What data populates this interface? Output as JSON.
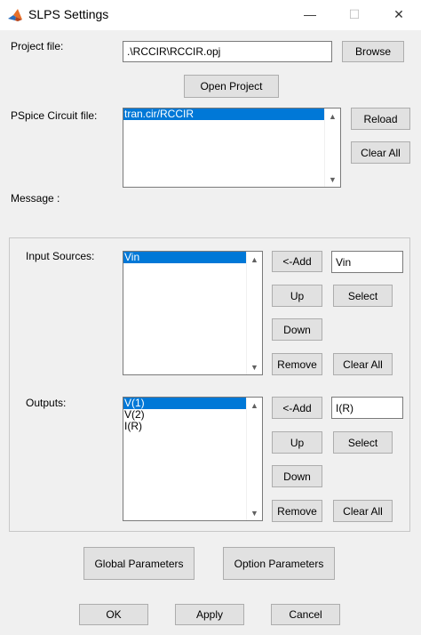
{
  "window": {
    "title": "SLPS Settings",
    "minimize": "—",
    "maximize": "☐",
    "close": "✕"
  },
  "project": {
    "label": "Project file:",
    "value": ".\\RCCIR\\RCCIR.opj",
    "browse": "Browse",
    "open": "Open Project"
  },
  "circuit": {
    "label": "PSpice Circuit file:",
    "items": [
      "tran.cir/RCCIR"
    ],
    "reload": "Reload",
    "clear_all": "Clear All"
  },
  "message": {
    "label": "Message :"
  },
  "inputs": {
    "label": "Input Sources:",
    "items": [
      "Vin"
    ],
    "add": "<-Add",
    "up": "Up",
    "down": "Down",
    "remove": "Remove",
    "field_value": "Vin",
    "select": "Select",
    "clear_all": "Clear All"
  },
  "outputs": {
    "label": "Outputs:",
    "items": [
      "V(1)",
      "V(2)",
      "I(R)"
    ],
    "add": "<-Add",
    "up": "Up",
    "down": "Down",
    "remove": "Remove",
    "field_value": "I(R)",
    "select": "Select",
    "clear_all": "Clear All"
  },
  "footer": {
    "global_parameters": "Global Parameters",
    "option_parameters": "Option Parameters",
    "ok": "OK",
    "apply": "Apply",
    "cancel": "Cancel"
  }
}
